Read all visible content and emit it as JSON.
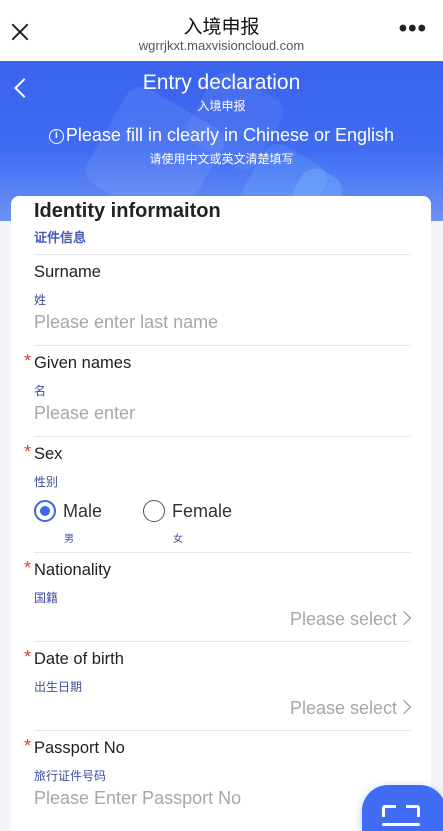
{
  "topbar": {
    "title": "入境申报",
    "url": "wgrrjkxt.maxvisioncloud.com",
    "more": "•••"
  },
  "header": {
    "title": "Entry declaration",
    "title_cn": "入境申报",
    "note": "Please fill in clearly in Chinese or English",
    "note_cn": "请使用中文或英文清楚填写",
    "info_glyph": "i"
  },
  "section": {
    "title": "Identity informaiton",
    "title_cn": "证件信息"
  },
  "fields": {
    "surname": {
      "label": "Surname",
      "label_cn": "姓",
      "placeholder": "Please enter last name"
    },
    "given_names": {
      "required_mark": "*",
      "label": "Given names",
      "label_cn": "名",
      "placeholder": "Please enter"
    },
    "sex": {
      "required_mark": "*",
      "label": "Sex",
      "label_cn": "性别",
      "options": [
        {
          "label": "Male",
          "label_cn": "男",
          "selected": true
        },
        {
          "label": "Female",
          "label_cn": "女",
          "selected": false
        }
      ]
    },
    "nationality": {
      "required_mark": "*",
      "label": "Nationality",
      "label_cn": "国籍",
      "value": "Please select"
    },
    "dob": {
      "required_mark": "*",
      "label": "Date of birth",
      "label_cn": "出生日期",
      "value": "Please select"
    },
    "passport": {
      "required_mark": "*",
      "label": "Passport No",
      "label_cn": "旅行证件号码",
      "placeholder": "Please Enter Passport No"
    }
  },
  "colors": {
    "accent": "#3f6cf2",
    "required": "#e33a3a",
    "sublabel": "#3d4e9e",
    "placeholder": "#a7a7a7"
  },
  "icons": [
    "close-icon",
    "more-icon",
    "back-chevron-icon",
    "info-icon",
    "chevron-right-icon",
    "scan-icon"
  ]
}
